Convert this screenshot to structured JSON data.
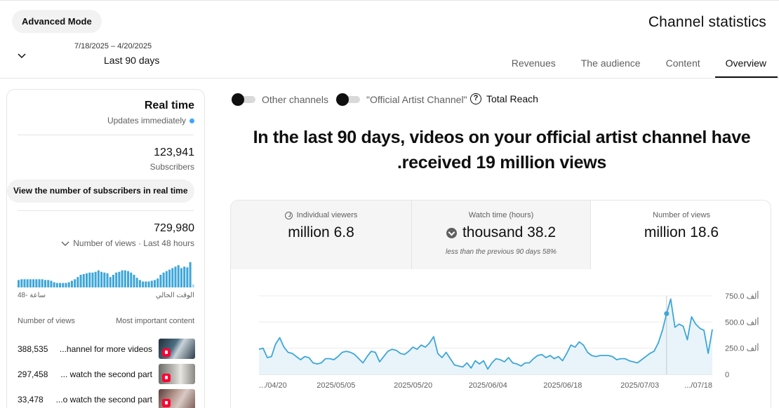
{
  "header": {
    "advanced_mode": "Advanced Mode",
    "title": "Channel statistics",
    "date_range": "7/18/2025 – 4/20/2025",
    "period": "Last 90 days",
    "tabs": [
      "Revenues",
      "The audience",
      "Content",
      "Overview"
    ],
    "active_tab": "Overview"
  },
  "realtime": {
    "title": "Real time",
    "subtitle": "Updates immediately",
    "subscribers_value": "123,941",
    "subscribers_label": "Subscribers",
    "realtime_button": "View the number of subscribers in real time",
    "views_value": "729,980",
    "views_label": "Number of views · Last 48 hours",
    "chart_left_label": "48- ساعة",
    "chart_right_label": "الوقت الحالي",
    "bars": [
      10,
      11,
      11,
      11,
      11,
      11,
      11,
      11,
      11,
      10,
      10,
      9,
      7,
      6,
      6,
      6,
      6,
      7,
      9,
      11,
      14,
      17,
      18,
      19,
      20,
      20,
      21,
      23,
      21,
      20,
      19,
      14,
      17,
      20,
      21,
      23,
      23,
      22,
      20,
      17,
      13,
      10,
      8,
      8,
      8,
      9,
      10,
      12,
      17,
      20,
      22,
      24,
      26,
      28,
      30,
      26,
      28,
      27,
      34,
      4
    ],
    "col_views": "Number of views",
    "col_content": "Most important content",
    "top_content": [
      {
        "views": "388,535",
        "title": "...hannel for more videos",
        "thumb": "#2b3b4a"
      },
      {
        "views": "297,458",
        "title": "... watch the second part",
        "thumb": "#9a9a98"
      },
      {
        "views": "33,478",
        "title": "...o watch the second part",
        "thumb": "#7a5a55"
      }
    ]
  },
  "filters": {
    "other_channels": "Other channels",
    "official_channel": "\"Official Artist Channel\"",
    "help_symbol": "?",
    "total_reach": "Total Reach"
  },
  "headline": "In the last 90 days, videos on your official artist channel have .received 19 million views",
  "stats": {
    "viewers_label": "Individual viewers",
    "viewers_value": "million 6.8",
    "watch_label": "Watch time (hours)",
    "watch_value": "thousand 38.2",
    "watch_note": "less than the previous 90 days 58%",
    "views_label": "Number of views",
    "views_value": "million 18.6"
  },
  "chart_data": {
    "type": "area",
    "xlabels": [
      ".../04/20",
      "2025/05/05",
      "2025/05/20",
      "2025/06/04",
      "2025/06/18",
      "2025/07/03",
      ".../07/18"
    ],
    "ylabels": [
      "0",
      "250.0 ألف",
      "500.0 ألف",
      "750.0 ألف"
    ],
    "ylim": [
      0,
      750000
    ],
    "values": [
      240,
      250,
      160,
      170,
      290,
      350,
      260,
      210,
      200,
      170,
      140,
      170,
      160,
      110,
      100,
      110,
      150,
      150,
      140,
      170,
      210,
      220,
      210,
      190,
      150,
      110,
      170,
      220,
      210,
      120,
      170,
      220,
      240,
      230,
      200,
      190,
      220,
      260,
      240,
      280,
      260,
      300,
      360,
      200,
      160,
      210,
      150,
      90,
      80,
      70,
      110,
      60,
      130,
      100,
      130,
      50,
      110,
      150,
      140,
      120,
      160,
      110,
      100,
      80,
      110,
      110,
      150,
      180,
      190,
      160,
      180,
      150,
      170,
      130,
      200,
      280,
      260,
      310,
      280,
      210,
      180,
      170,
      180,
      180,
      180,
      170,
      140,
      150,
      150,
      130,
      120,
      110,
      140,
      170,
      200,
      220,
      300,
      420,
      580,
      720,
      450,
      480,
      460,
      330,
      550,
      480,
      440,
      420,
      200,
      430
    ],
    "value_unit": "thousands",
    "line_color": "#3ea6d8",
    "fill_color": "#e8f4fa"
  }
}
